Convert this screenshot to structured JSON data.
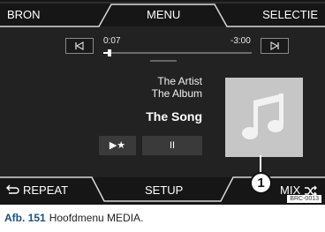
{
  "top_bar": {
    "source_label": "BRON",
    "menu_label": "MENU",
    "select_label": "SELECTIE"
  },
  "player": {
    "prev_icon": "skip-back-icon",
    "next_icon": "skip-forward-icon",
    "elapsed": "0:07",
    "remaining": "-3:00",
    "progress_fraction": 0.04,
    "artist": "The Artist",
    "album": "The Album",
    "song": "The Song",
    "play_fav_label": "▶★",
    "pause_label": "II",
    "cover_icon": "music-note-icon"
  },
  "bottom_bar": {
    "repeat_label": "REPEAT",
    "setup_label": "SETUP",
    "mix_label": "MIX"
  },
  "callout": {
    "number": "1"
  },
  "image_code": "BRC-0013",
  "caption": {
    "figure_label": "Afb. 151",
    "text": "Hoofdmenu MEDIA."
  },
  "colors": {
    "screen_bg": "#222222",
    "bar_bg": "#161616",
    "cover_bg": "#c6c6c6",
    "caption_fig": "#1f4f7a"
  }
}
